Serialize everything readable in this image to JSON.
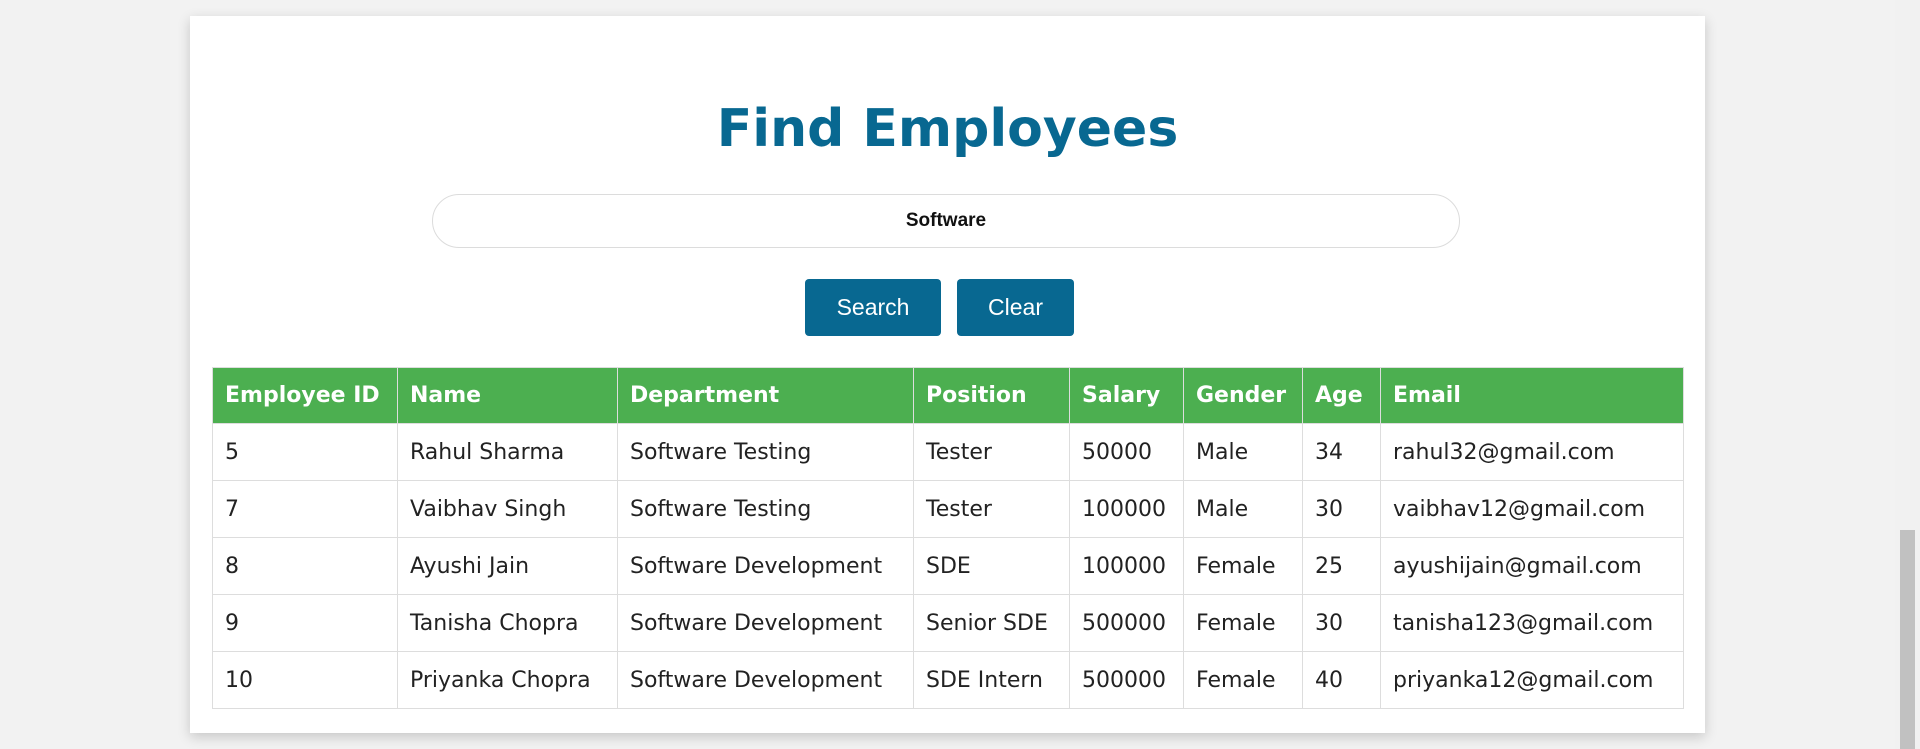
{
  "page": {
    "title": "Find Employees"
  },
  "search": {
    "value": "Software",
    "search_label": "Search",
    "clear_label": "Clear"
  },
  "table": {
    "headers": [
      "Employee ID",
      "Name",
      "Department",
      "Position",
      "Salary",
      "Gender",
      "Age",
      "Email"
    ],
    "rows": [
      [
        "5",
        "Rahul Sharma",
        "Software Testing",
        "Tester",
        "50000",
        "Male",
        "34",
        "rahul32@gmail.com"
      ],
      [
        "7",
        "Vaibhav Singh",
        "Software Testing",
        "Tester",
        "100000",
        "Male",
        "30",
        "vaibhav12@gmail.com"
      ],
      [
        "8",
        "Ayushi Jain",
        "Software Development",
        "SDE",
        "100000",
        "Female",
        "25",
        "ayushijain@gmail.com"
      ],
      [
        "9",
        "Tanisha Chopra",
        "Software Development",
        "Senior SDE",
        "500000",
        "Female",
        "30",
        "tanisha123@gmail.com"
      ],
      [
        "10",
        "Priyanka Chopra",
        "Software Development",
        "SDE Intern",
        "500000",
        "Female",
        "40",
        "priyanka12@gmail.com"
      ]
    ]
  },
  "colors": {
    "title": "#086891",
    "button": "#086891",
    "table_header": "#4caf50"
  }
}
